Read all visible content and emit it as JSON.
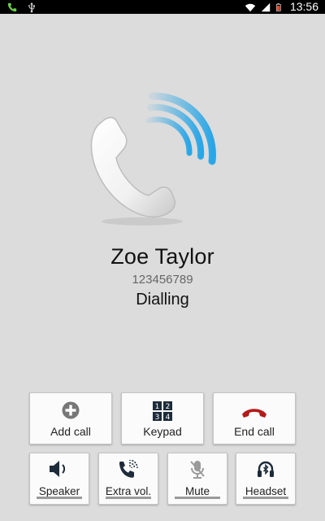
{
  "status_bar": {
    "time": "13:56",
    "icons_left": [
      "phone-call-icon",
      "usb-icon"
    ],
    "icons_right": [
      "wifi-icon",
      "signal-icon",
      "battery-icon"
    ]
  },
  "call": {
    "contact_name": "Zoe Taylor",
    "number": "123456789",
    "status": "Dialling"
  },
  "actions": {
    "add_call": "Add call",
    "keypad": "Keypad",
    "end_call": "End call"
  },
  "toggles": {
    "speaker": "Speaker",
    "extra_vol": "Extra vol.",
    "mute": "Mute",
    "headset": "Headset"
  },
  "colors": {
    "end_call_red": "#b31b1b",
    "ring_blue": "#2aa6e6",
    "icon_dark": "#1d2b3a"
  }
}
